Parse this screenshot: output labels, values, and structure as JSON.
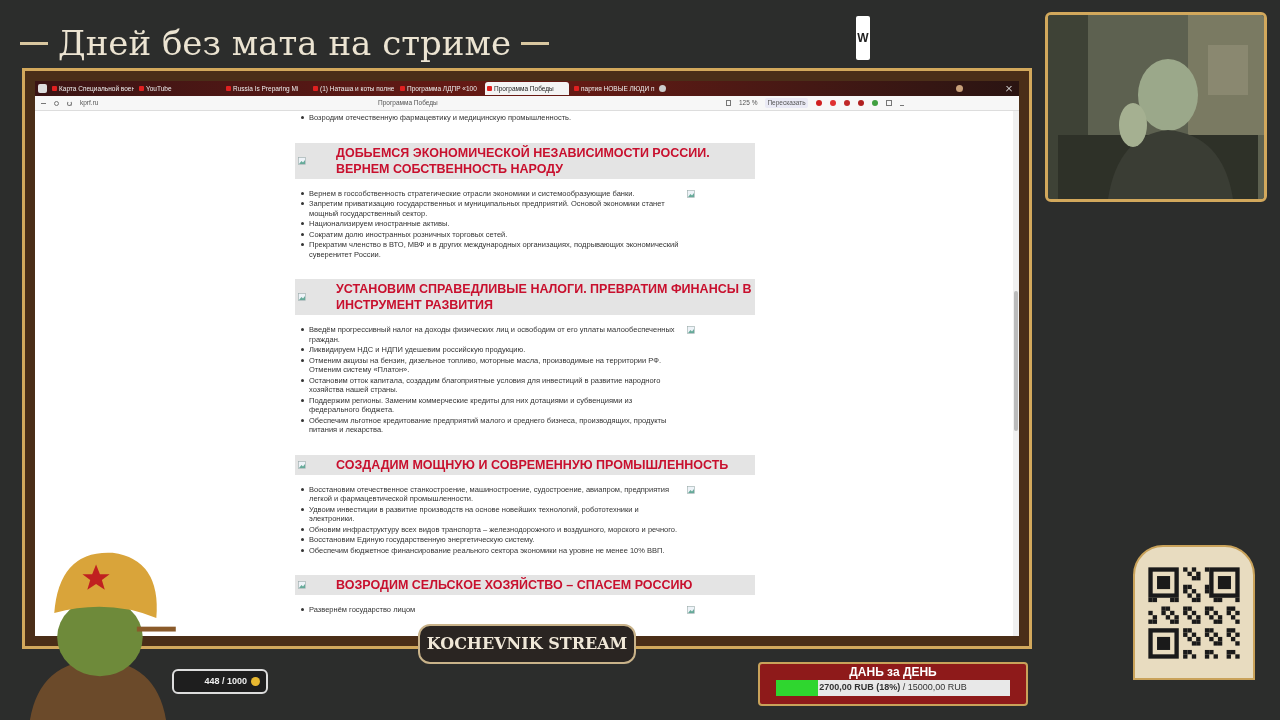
{
  "overlay": {
    "title": "Дней без мата на стриме",
    "logo": "W",
    "stream_name": "KOCHEVNIK STREAM",
    "counter": "448 / 1000",
    "goal": {
      "title": "ДАНЬ за ДЕНЬ",
      "level": 0.18,
      "raised": "2700,00 RUB (18%)",
      "target": " / 15000,00 RUB"
    }
  },
  "browser": {
    "tabs": [
      {
        "title": "Карта Специальной воен",
        "selected": false
      },
      {
        "title": "YouTube",
        "selected": false
      },
      {
        "title": "Russia Is Preparing Mi",
        "selected": false
      },
      {
        "title": "(1) Наташа и коты полне",
        "selected": false
      },
      {
        "title": "Программа ЛДПР «100 ",
        "selected": false
      },
      {
        "title": "Программа Победы",
        "selected": true
      },
      {
        "title": "партия НОВЫЕ ЛЮДИ п",
        "selected": false
      }
    ],
    "address": "kprf.ru",
    "page_title": "Программа Победы",
    "zoom": "125 %",
    "summarize_button": "Пересказать"
  },
  "page": {
    "lead_bullets": [
      "Возродим отечественную фармацевтику и медицинскую промышленность."
    ],
    "sections": [
      {
        "heading": "ДОБЬЕМСЯ ЭКОНОМИЧЕСКОЙ НЕЗАВИСИМОСТИ РОССИИ. ВЕРНЕМ СОБСТВЕННОСТЬ НАРОДУ",
        "bullets": [
          "Вернем в госсобственность стратегические отрасли экономики и системообразующие банки.",
          "Запретим приватизацию государственных и муниципальных предприятий. Основой экономики станет мощный государственный сектор.",
          "Национализируем иностранные активы.",
          "Сократим долю иностранных розничных торговых сетей.",
          "Прекратим членство в ВТО, МВФ и в других международных организациях, подрывающих экономический суверенитет России."
        ]
      },
      {
        "heading": "УСТАНОВИМ СПРАВЕДЛИВЫЕ НАЛОГИ. ПРЕВРАТИМ ФИНАНСЫ В ИНСТРУМЕНТ РАЗВИТИЯ",
        "bullets": [
          "Введём прогрессивный налог на доходы физических лиц и освободим от его уплаты малообеспеченных граждан.",
          "Ликвидируем НДС и НДПИ удешевим российскую продукцию.",
          "Отменим акцизы на бензин, дизельное топливо, моторные масла, производимые на территории РФ. Отменим систему «Платон».",
          "Остановим отток капитала, создадим благоприятные условия для инвестиций в развитие народного хозяйства нашей страны.",
          "Поддержим регионы. Заменим коммерческие кредиты для них дотациями и субвенциями из федерального бюджета.",
          "Обеспечим льготное кредитование предприятий малого и среднего бизнеса, производящих, продукты питания и лекарства."
        ]
      },
      {
        "heading": "СОЗДАДИМ МОЩНУЮ И СОВРЕМЕННУЮ ПРОМЫШЛЕННОСТЬ",
        "bullets": [
          "Восстановим отечественное станкостроение, машиностроение, судостроение, авиапром, предприятия легкой и фармацевтической промышленности.",
          "Удвоим инвестиции в развитие производств на основе новейших технологий, робототехники и электроники.",
          "Обновим инфраструктуру всех видов транспорта – железнодорожного и воздушного, морского и речного.",
          "Восстановим Единую государственную энергетическую систему.",
          "Обеспечим бюджетное финансирование реального сектора экономики на уровне не менее 10% ВВП."
        ]
      },
      {
        "heading": "ВОЗРОДИМ СЕЛЬСКОЕ ХОЗЯЙСТВО – СПАСЕМ РОССИЮ",
        "bullets": [
          "Развернём государство лицом"
        ]
      }
    ]
  }
}
